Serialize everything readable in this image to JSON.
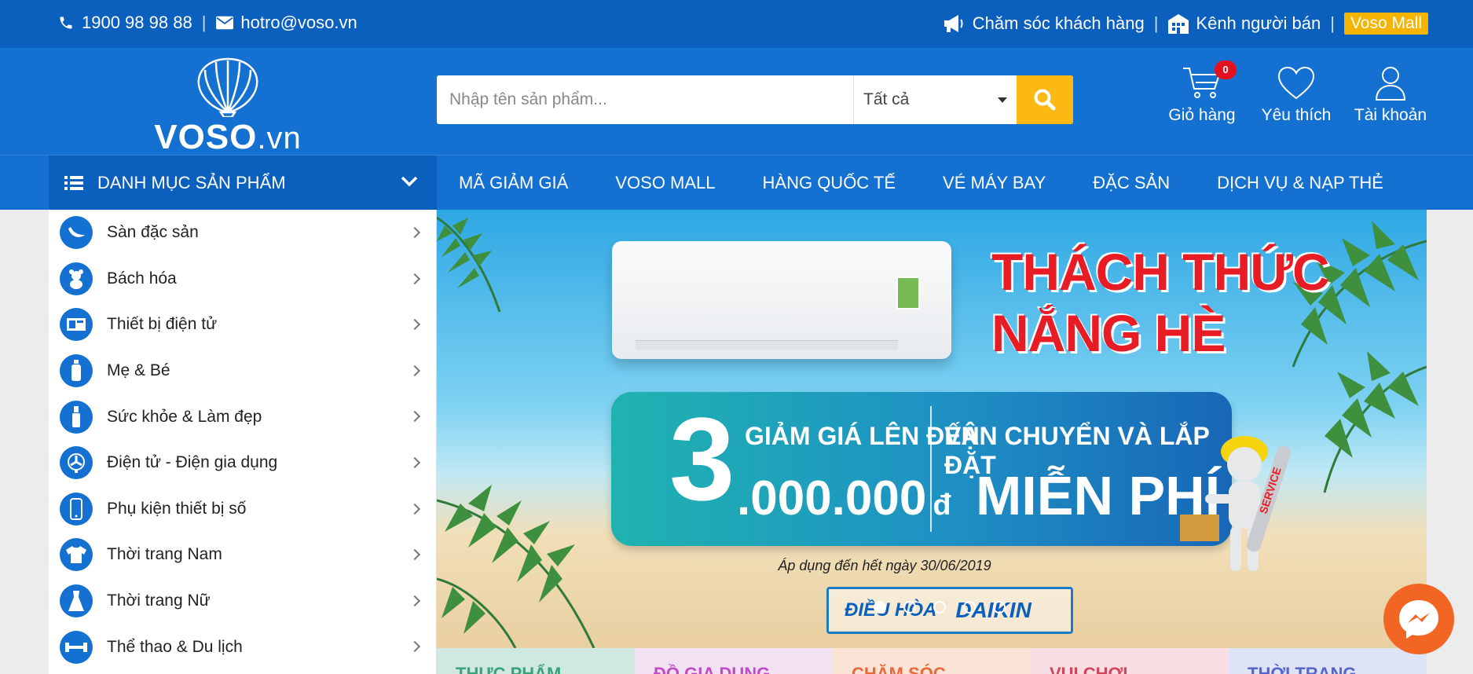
{
  "topbar": {
    "phone": "1900 98 98 88",
    "email": "hotro@voso.vn",
    "customer_care": "Chăm sóc khách hàng",
    "seller_channel": "Kênh người bán",
    "mall_badge": "Voso Mall"
  },
  "header": {
    "logo_text": "VOSO",
    "logo_suffix": ".vn",
    "search_placeholder": "Nhập tên sản phẩm...",
    "search_category": "Tất cả",
    "cart_label": "Giỏ hàng",
    "cart_count": "0",
    "wishlist_label": "Yêu thích",
    "account_label": "Tài khoản"
  },
  "nav": {
    "category_menu": "DANH MỤC SẢN PHẨM",
    "links": [
      "MÃ GIẢM GIÁ",
      "VOSO MALL",
      "HÀNG QUỐC TẾ",
      "VÉ MÁY BAY",
      "ĐẶC SẢN",
      "DỊCH VỤ & NẠP THẺ"
    ]
  },
  "sidebar": {
    "items": [
      {
        "label": "Sàn đặc sản",
        "icon": "banana-icon"
      },
      {
        "label": "Bách hóa",
        "icon": "teddy-icon"
      },
      {
        "label": "Thiết bị điện tử",
        "icon": "appliance-icon"
      },
      {
        "label": "Mẹ & Bé",
        "icon": "bottle-icon"
      },
      {
        "label": "Sức khỏe & Làm đẹp",
        "icon": "cosmetic-icon"
      },
      {
        "label": "Điện tử - Điện gia dụng",
        "icon": "fan-icon"
      },
      {
        "label": "Phụ kiện thiết bị số",
        "icon": "phone-icon"
      },
      {
        "label": "Thời trang Nam",
        "icon": "shirt-icon"
      },
      {
        "label": "Thời trang Nữ",
        "icon": "dress-icon"
      },
      {
        "label": "Thể thao & Du lịch",
        "icon": "dumbbell-icon"
      }
    ]
  },
  "banner": {
    "headline_1": "THÁCH THỨC",
    "headline_2": "NẮNG HÈ",
    "big_number": "3",
    "discount_label": "GIẢM GIÁ LÊN ĐẾN",
    "discount_amount": ".000.000",
    "currency": "đ",
    "shipping_label": "VẬN CHUYỂN VÀ LẮP ĐẶT",
    "free": "MIỄN PHÍ",
    "apply_text": "Áp dụng đến hết ngày 30/06/2019",
    "brand_tag": "ĐIỀU HÒA",
    "brand_logo": "DAIKIN",
    "service_tag": "SERVICE",
    "slide_count": 5,
    "active_slide": 0
  },
  "strip": {
    "items": [
      {
        "label": "THỰC PHẨM",
        "bg": "#cfe8e0",
        "color": "#3aa37a"
      },
      {
        "label": "ĐỒ GIA DỤNG",
        "bg": "#f2e0f3",
        "color": "#c04bc4"
      },
      {
        "label": "CHĂM SÓC",
        "bg": "#fbe3d6",
        "color": "#e86a3a"
      },
      {
        "label": "VUI CHƠI",
        "bg": "#f9dfe4",
        "color": "#d2445c"
      },
      {
        "label": "THỜI TRANG",
        "bg": "#dfe3f7",
        "color": "#5566c8"
      }
    ]
  },
  "colors": {
    "primary": "#1470d1",
    "primary_dark": "#0b5fbd",
    "accent": "#fdb913",
    "badge_red": "#e5101d",
    "messenger": "#f26522"
  }
}
